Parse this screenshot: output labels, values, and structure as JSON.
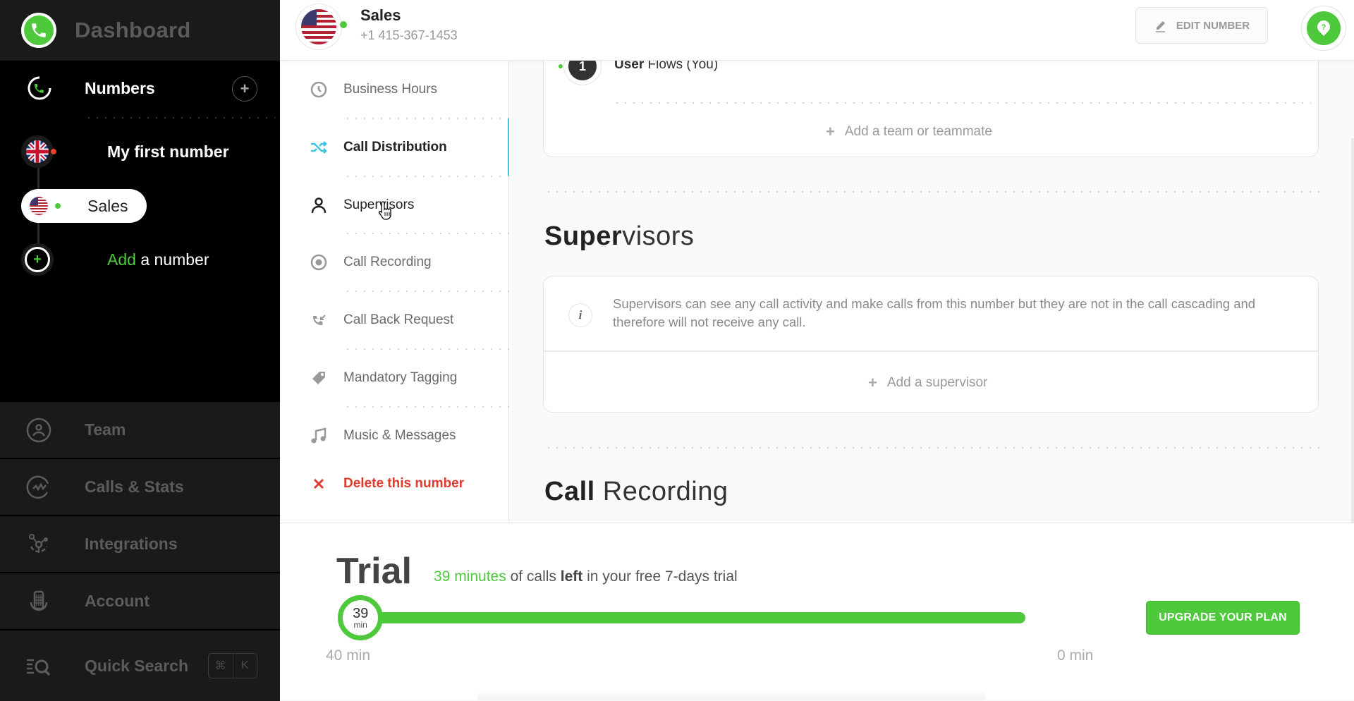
{
  "sidebar": {
    "app_title": "Dashboard",
    "numbers_label": "Numbers",
    "numbers": [
      {
        "label": "My first number",
        "country": "GB",
        "status": "offline",
        "status_color": "#e8412c"
      },
      {
        "label": "Sales",
        "country": "US",
        "status": "online",
        "status_color": "#4dc93b",
        "selected": true
      }
    ],
    "add_number": {
      "highlight": "Add",
      "rest": " a number"
    },
    "menu": [
      {
        "label": "Team",
        "icon": "team-icon"
      },
      {
        "label": "Calls & Stats",
        "icon": "stats-icon"
      },
      {
        "label": "Integrations",
        "icon": "integrations-icon"
      },
      {
        "label": "Account",
        "icon": "account-icon"
      }
    ],
    "quick_search": {
      "label": "Quick Search",
      "shortcut": [
        "⌘",
        "K"
      ]
    }
  },
  "header": {
    "number_name": "Sales",
    "phone": "+1 415-367-1453",
    "edit_button": "EDIT NUMBER"
  },
  "section_nav": {
    "items": [
      {
        "label": "Business Hours",
        "icon": "clock-icon"
      },
      {
        "label": "Call Distribution",
        "icon": "shuffle-icon",
        "active": true
      },
      {
        "label": "Supervisors",
        "icon": "person-icon",
        "hover": true
      },
      {
        "label": "Call Recording",
        "icon": "record-icon"
      },
      {
        "label": "Call Back Request",
        "icon": "callback-icon"
      },
      {
        "label": "Mandatory Tagging",
        "icon": "tag-icon"
      },
      {
        "label": "Music & Messages",
        "icon": "music-icon"
      }
    ],
    "delete_label": "Delete this number"
  },
  "main": {
    "call_distribution": {
      "position": "1",
      "user_bold": "User",
      "user_rest": " Flows (You)",
      "add_label": "Add a team or teammate"
    },
    "supervisors": {
      "title_bold": "Super",
      "title_rest": "visors",
      "info": "Supervisors can see any call activity and make calls from this number but they are not in the call cascading and therefore will not receive any call.",
      "add_label": "Add a supervisor"
    },
    "call_recording": {
      "title_bold": "Call",
      "title_rest": " Recording"
    }
  },
  "trial": {
    "title": "Trial",
    "minutes_highlight": "39 minutes",
    "msg_mid": " of calls ",
    "msg_bold": "left",
    "msg_end": " in your free 7-days trial",
    "remaining_minutes": 39,
    "total_minutes": 40,
    "knob_value": "39",
    "knob_unit": "min",
    "start_label": "40 min",
    "end_label": "0 min",
    "upgrade_button": "UPGRADE YOUR PLAN"
  },
  "colors": {
    "accent_green": "#4dc93b",
    "active_blue": "#3ec3e6",
    "danger_red": "#e23a2e"
  }
}
